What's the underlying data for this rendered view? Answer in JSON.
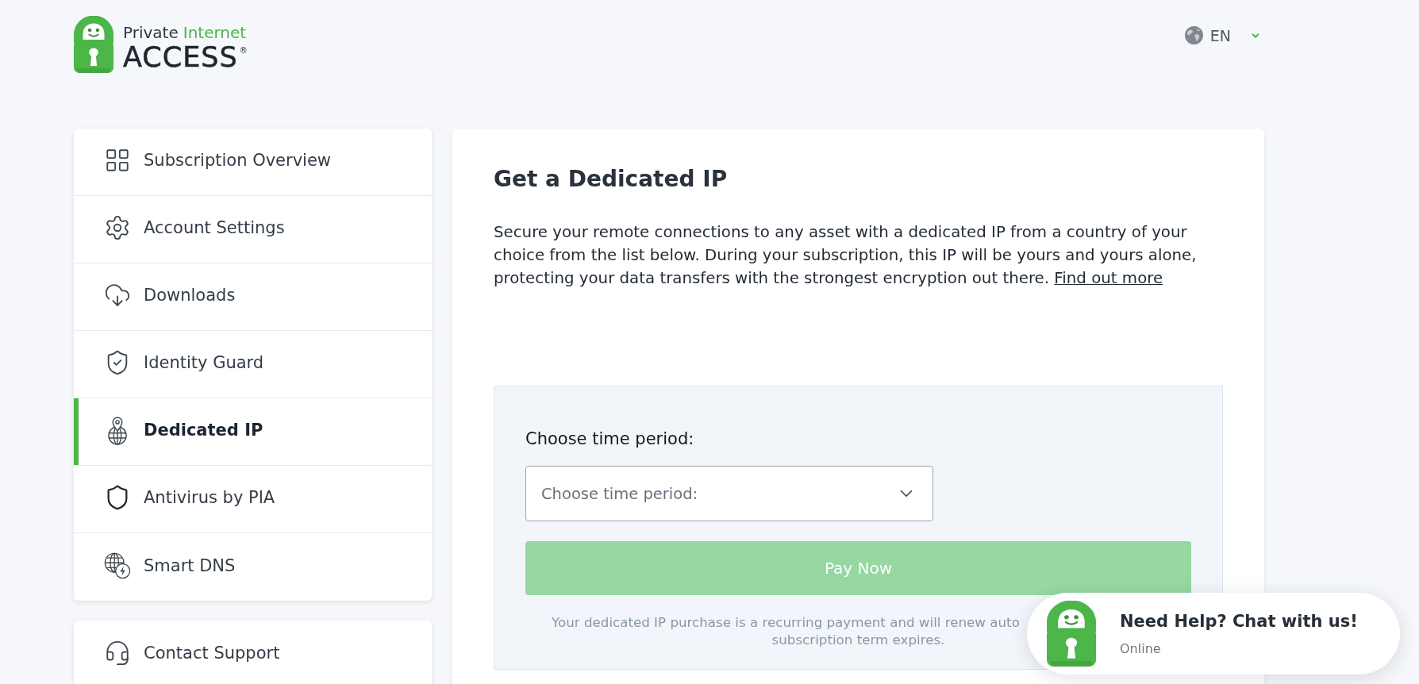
{
  "header": {
    "logo": {
      "word_1": "Private",
      "word_2": "Internet",
      "word_3": "ACCESS",
      "mark": "®"
    },
    "language": {
      "label": "EN"
    }
  },
  "sidebar": {
    "items": [
      {
        "label": "Subscription Overview",
        "selected": false
      },
      {
        "label": "Account Settings",
        "selected": false
      },
      {
        "label": "Downloads",
        "selected": false
      },
      {
        "label": "Identity Guard",
        "selected": false
      },
      {
        "label": "Dedicated IP",
        "selected": true
      },
      {
        "label": "Antivirus by PIA",
        "selected": false
      },
      {
        "label": "Smart DNS",
        "selected": false
      }
    ],
    "support_items": [
      {
        "label": "Contact Support",
        "selected": false
      }
    ]
  },
  "main": {
    "title": "Get a Dedicated IP",
    "description": "Secure your remote connections to any asset with a dedicated IP from a country of your choice from the list below. During your subscription, this IP will be yours and yours alone, protecting your data transfers with the strongest encryption out there.",
    "link": "Find out more",
    "form": {
      "label": "Choose time period:",
      "select": {
        "placeholder": "Choose time period:"
      },
      "button": {
        "label": "Pay Now",
        "disabled": true
      },
      "note_lines": [
        "Your dedicated IP purchase is a recurring payment and will renew auto",
        "subscription term expires."
      ]
    }
  },
  "chat_widget": {
    "title": "Need Help? Chat with us!",
    "status": "Online"
  }
}
